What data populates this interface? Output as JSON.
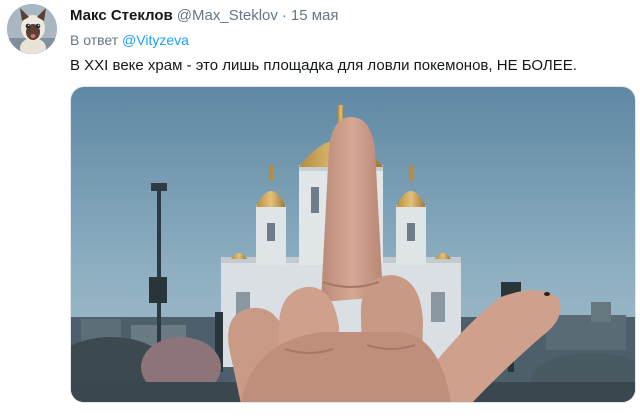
{
  "tweet": {
    "display_name": "Макс Стеклов",
    "handle": "@Max_Steklov",
    "separator": "·",
    "date": "15 мая",
    "reply_prefix": "В ответ",
    "reply_to": "@Vityzeva",
    "text": "В XXI веке храм - это лишь площадка для ловли покемонов, НЕ БОЛЕЕ."
  },
  "colors": {
    "link": "#1da1f2",
    "secondary_text": "#657786",
    "primary_text": "#14171a"
  },
  "icons": {
    "avatar": "siamese-cat-avatar",
    "photo": "cathedral-middle-finger-photo"
  }
}
